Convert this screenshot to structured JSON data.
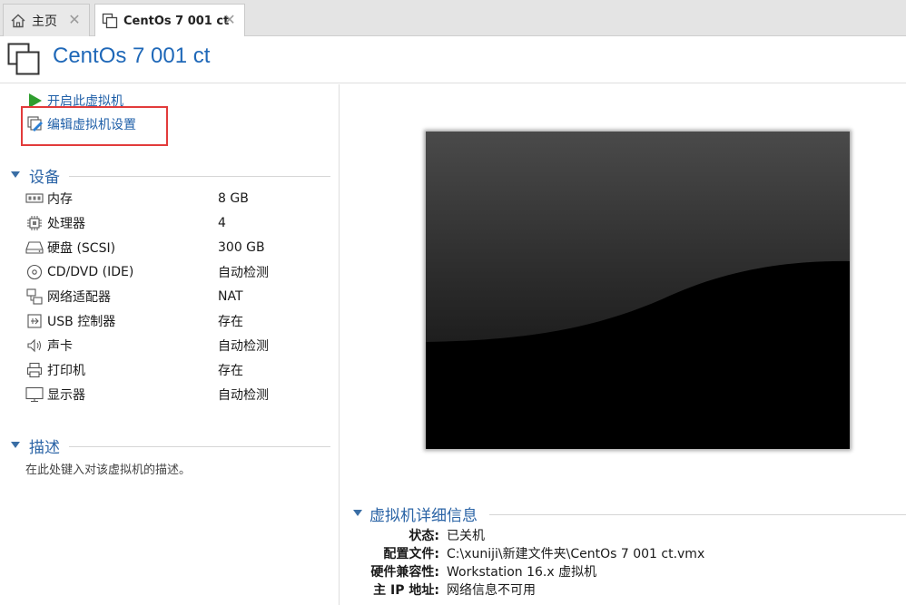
{
  "tabs": [
    {
      "label": "主页",
      "icon": "home-icon",
      "active": false
    },
    {
      "label": "CentOs 7 001 ct",
      "icon": "vm-icon",
      "active": true
    }
  ],
  "header": {
    "title": "CentOs 7 001 ct"
  },
  "actions": {
    "start_label": "开启此虚拟机",
    "edit_label": "编辑虚拟机设置"
  },
  "devices": {
    "section_title": "设备",
    "items": [
      {
        "name": "内存",
        "value": "8 GB",
        "icon": "memory-icon"
      },
      {
        "name": "处理器",
        "value": "4",
        "icon": "processor-icon"
      },
      {
        "name": "硬盘 (SCSI)",
        "value": "300 GB",
        "icon": "hard-disk-icon"
      },
      {
        "name": "CD/DVD (IDE)",
        "value": "自动检测",
        "icon": "cd-dvd-icon"
      },
      {
        "name": "网络适配器",
        "value": "NAT",
        "icon": "network-adapter-icon"
      },
      {
        "name": "USB 控制器",
        "value": "存在",
        "icon": "usb-icon"
      },
      {
        "name": "声卡",
        "value": "自动检测",
        "icon": "sound-card-icon"
      },
      {
        "name": "打印机",
        "value": "存在",
        "icon": "printer-icon"
      },
      {
        "name": "显示器",
        "value": "自动检测",
        "icon": "display-icon"
      }
    ]
  },
  "description": {
    "section_title": "描述",
    "placeholder": "在此处键入对该虚拟机的描述。"
  },
  "details": {
    "section_title": "虚拟机详细信息",
    "rows": [
      {
        "key": "状态:",
        "value": "已关机"
      },
      {
        "key": "配置文件:",
        "value": "C:\\xuniji\\新建文件夹\\CentOs 7 001 ct.vmx"
      },
      {
        "key": "硬件兼容性:",
        "value": "Workstation 16.x 虚拟机"
      },
      {
        "key": "主 IP 地址:",
        "value": "网络信息不可用"
      }
    ]
  },
  "colors": {
    "accent": "#1f68b8",
    "link": "#1f5fa8",
    "highlight_border": "#e23b3b",
    "start_green": "#2f9e2f"
  }
}
